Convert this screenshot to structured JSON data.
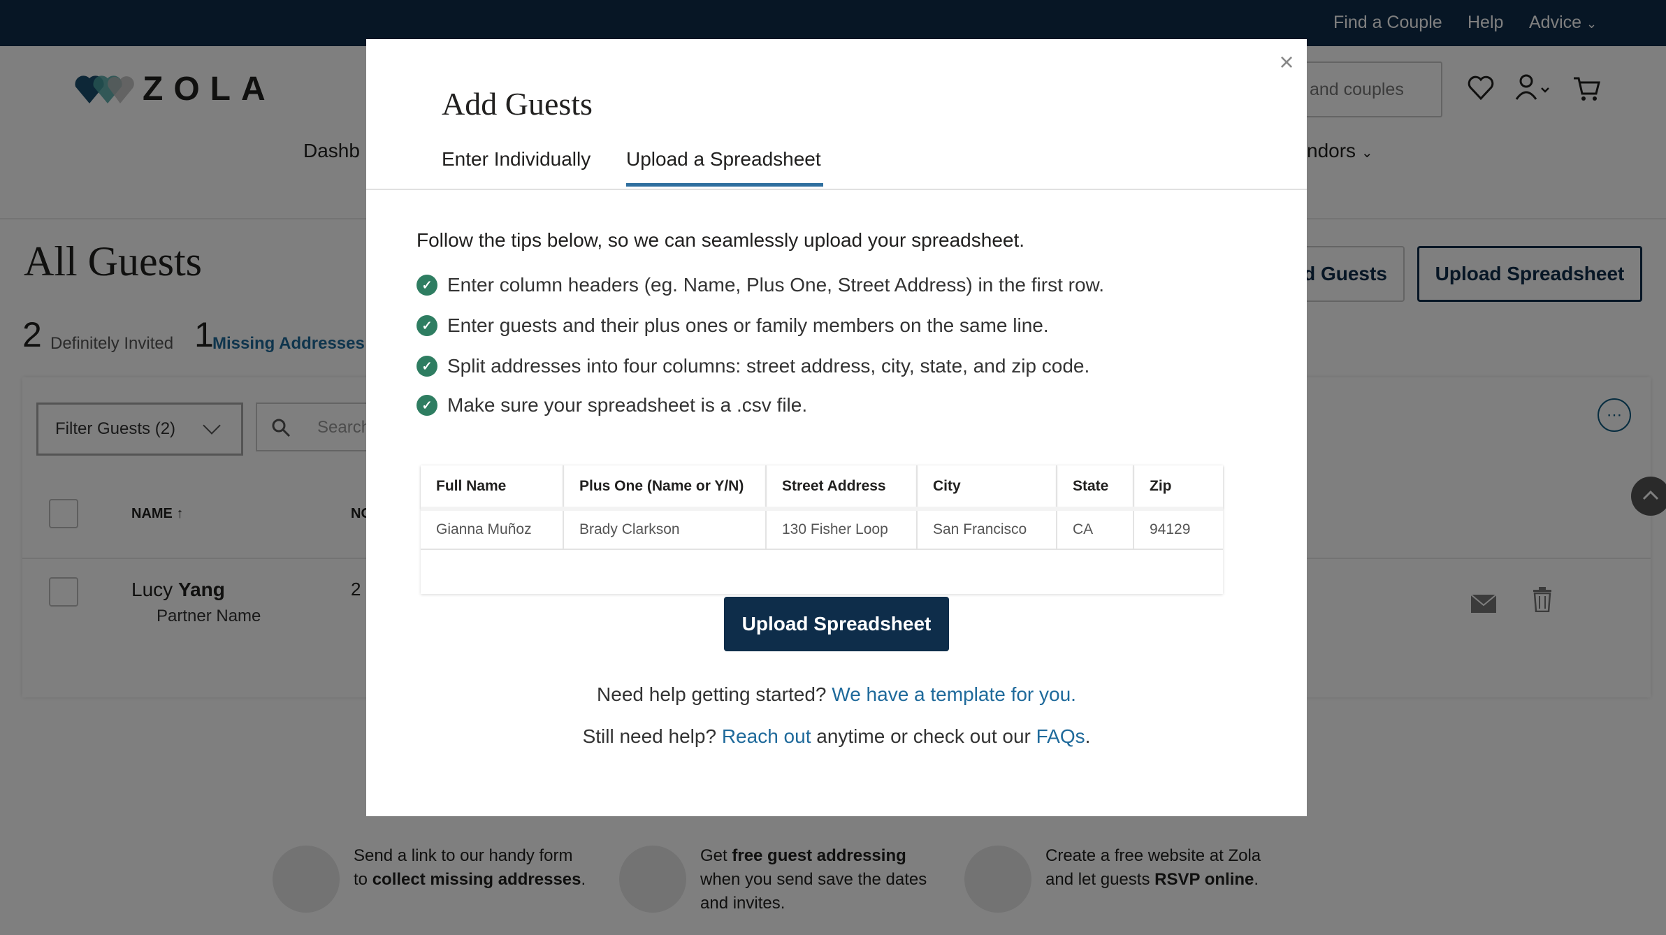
{
  "topbar": {
    "links": [
      "Find a Couple",
      "Help",
      "Advice"
    ]
  },
  "header": {
    "logo_text": "ZOLA",
    "search_placeholder": "and couples",
    "nav_left_partial": "Dashb",
    "nav_right_partial": "ndors"
  },
  "page": {
    "title": "All Guests",
    "stats": [
      {
        "number": "2",
        "label": "Definitely Invited"
      },
      {
        "number": "1",
        "label": "Missing Addresses"
      }
    ],
    "add_guests_partial": "d Guests",
    "upload_button": "Upload Spreadsheet",
    "filter_label": "Filter Guests (2)",
    "search_partial": "Search",
    "table": {
      "name_header": "NAME",
      "sort_arrow": "↑",
      "second_header_partial": "NO",
      "row": {
        "first": "Lucy",
        "last": "Yang",
        "partner": "Partner Name",
        "count_partial": "2"
      }
    }
  },
  "promos": [
    {
      "line1": "Send a link to our handy form",
      "line2_prefix": "to ",
      "line2_bold": "collect missing addresses",
      "line2_suffix": "."
    },
    {
      "line1_prefix": "Get ",
      "line1_bold": "free guest addressing",
      "line2": "when you send save the dates",
      "line3": "and invites."
    },
    {
      "line1": "Create a free website at Zola",
      "line2_prefix": "and let guests ",
      "line2_bold": "RSVP online",
      "line2_suffix": "."
    }
  ],
  "modal": {
    "close_icon": "×",
    "title": "Add Guests",
    "tabs": [
      "Enter Individually",
      "Upload a Spreadsheet"
    ],
    "tips_heading": "Follow the tips below, so we can seamlessly upload your spreadsheet.",
    "tips": [
      "Enter column headers (eg. Name, Plus One, Street Address) in the first row.",
      "Enter guests and their plus ones or family members on the same line.",
      "Split addresses into four columns: street address, city, state, and zip code.",
      "Make sure your spreadsheet is a .csv file."
    ],
    "sample_table": {
      "headers": [
        "Full Name",
        "Plus One (Name or Y/N)",
        "Street Address",
        "City",
        "State",
        "Zip"
      ],
      "row": [
        "Gianna Muñoz",
        "Brady Clarkson",
        "130 Fisher Loop",
        "San Francisco",
        "CA",
        "94129"
      ]
    },
    "upload_button": "Upload Spreadsheet",
    "help1_text": "Need help getting started? ",
    "help1_link": "We have a template for you.",
    "help2_text": "Still need help? ",
    "help2_link1": "Reach out",
    "help2_mid": " anytime or check out our ",
    "help2_link2": "FAQs",
    "help2_end": "."
  },
  "colors": {
    "navy": "#0e2d4a",
    "link_blue": "#1f6a9b",
    "check_green": "#2e7d61"
  }
}
